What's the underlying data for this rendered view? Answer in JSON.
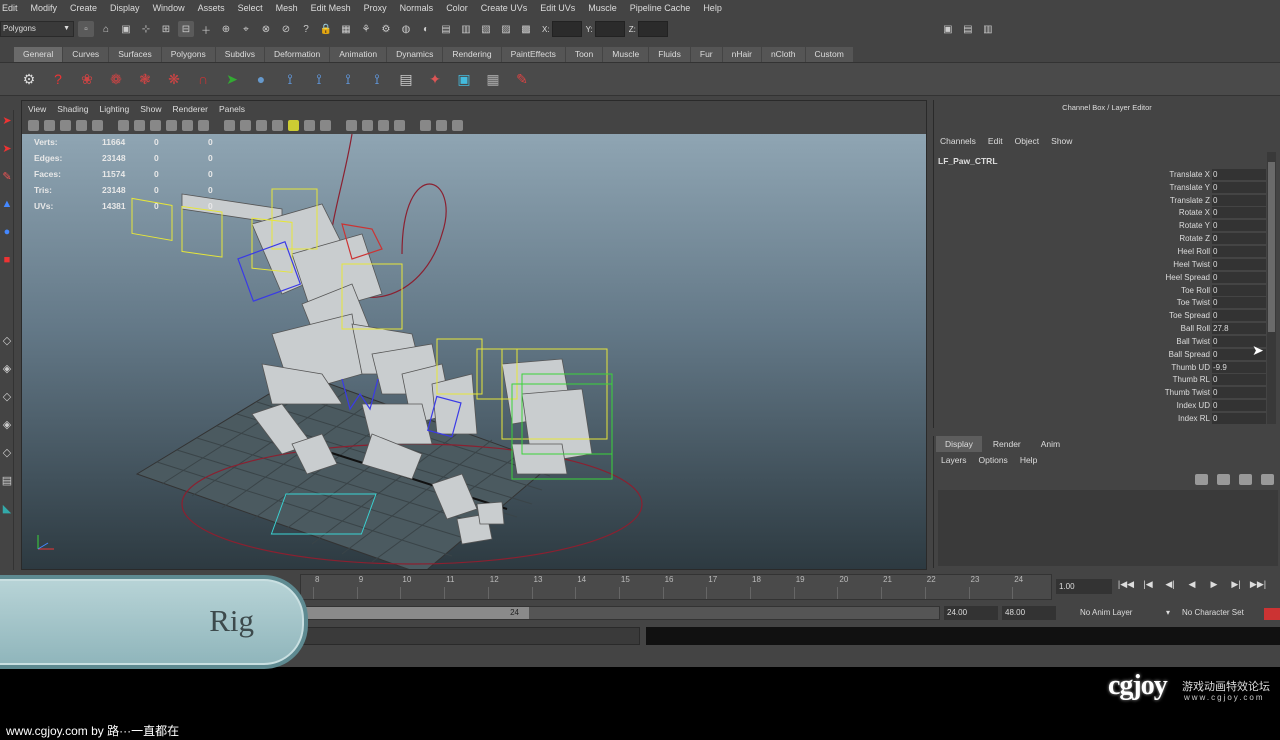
{
  "menubar": [
    "Edit",
    "Modify",
    "Create",
    "Display",
    "Window",
    "Assets",
    "Select",
    "Mesh",
    "Edit Mesh",
    "Proxy",
    "Normals",
    "Color",
    "Create UVs",
    "Edit UVs",
    "Muscle",
    "Pipeline Cache",
    "Help"
  ],
  "status_line": {
    "mode": "Polygons",
    "x_label": "X:",
    "y_label": "Y:",
    "z_label": "Z:"
  },
  "shelf_tabs": [
    "General",
    "Curves",
    "Surfaces",
    "Polygons",
    "Subdivs",
    "Deformation",
    "Animation",
    "Dynamics",
    "Rendering",
    "PaintEffects",
    "Toon",
    "Muscle",
    "Fluids",
    "Fur",
    "nHair",
    "nCloth",
    "Custom"
  ],
  "shelf_active": "General",
  "viewport": {
    "menu": [
      "View",
      "Shading",
      "Lighting",
      "Show",
      "Renderer",
      "Panels"
    ],
    "hud": [
      {
        "key": "Verts:",
        "value": "11664",
        "c1": "0",
        "c2": "0"
      },
      {
        "key": "Edges:",
        "value": "23148",
        "c1": "0",
        "c2": "0"
      },
      {
        "key": "Faces:",
        "value": "11574",
        "c1": "0",
        "c2": "0"
      },
      {
        "key": "Tris:",
        "value": "23148",
        "c1": "0",
        "c2": "0"
      },
      {
        "key": "UVs:",
        "value": "14381",
        "c1": "0",
        "c2": "0"
      }
    ]
  },
  "channel_box": {
    "title": "Channel Box / Layer Editor",
    "menu": [
      "Channels",
      "Edit",
      "Object",
      "Show"
    ],
    "object": "LF_Paw_CTRL",
    "channels": [
      {
        "name": "Translate X",
        "value": "0"
      },
      {
        "name": "Translate Y",
        "value": "0"
      },
      {
        "name": "Translate Z",
        "value": "0"
      },
      {
        "name": "Rotate X",
        "value": "0"
      },
      {
        "name": "Rotate Y",
        "value": "0"
      },
      {
        "name": "Rotate Z",
        "value": "0"
      },
      {
        "name": "Heel Roll",
        "value": "0"
      },
      {
        "name": "Heel Twist",
        "value": "0"
      },
      {
        "name": "Heel Spread",
        "value": "0"
      },
      {
        "name": "Toe Roll",
        "value": "0"
      },
      {
        "name": "Toe Twist",
        "value": "0"
      },
      {
        "name": "Toe Spread",
        "value": "0"
      },
      {
        "name": "Ball Roll",
        "value": "27.8"
      },
      {
        "name": "Ball Twist",
        "value": "0"
      },
      {
        "name": "Ball Spread",
        "value": "0"
      },
      {
        "name": "Thumb UD",
        "value": "-9.9"
      },
      {
        "name": "Thumb RL",
        "value": "0"
      },
      {
        "name": "Thumb Twist",
        "value": "0"
      },
      {
        "name": "Index UD",
        "value": "0"
      },
      {
        "name": "Index RL",
        "value": "0"
      }
    ]
  },
  "layer_editor": {
    "tabs": [
      "Display",
      "Render",
      "Anim"
    ],
    "active_tab": "Display",
    "menu": [
      "Layers",
      "Options",
      "Help"
    ]
  },
  "time_slider": {
    "ticks": [
      "8",
      "9",
      "10",
      "11",
      "12",
      "13",
      "14",
      "15",
      "16",
      "17",
      "18",
      "19",
      "20",
      "21",
      "22",
      "23",
      "24"
    ],
    "current_time": "1.00"
  },
  "range_slider": {
    "handle_label": "24",
    "end_time": "24.00",
    "playback_end": "48.00",
    "anim_layer": "No Anim Layer",
    "character_set": "No Character Set"
  },
  "banner_text": "Rig",
  "footer_text": "www.cgjoy.com by 路···一直都在",
  "logo": {
    "text": "cgjoy",
    "cn": "游戏动画特效论坛",
    "url": "www.cgjoy.com"
  },
  "axis_label": "z x"
}
